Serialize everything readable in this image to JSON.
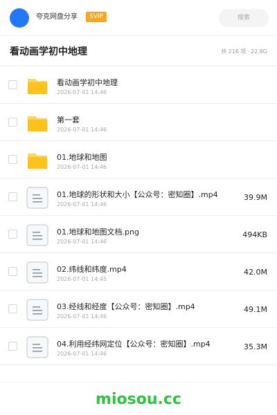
{
  "header": {
    "username": "夸克网盘分享",
    "badge": "SVIP",
    "search_placeholder": "搜索",
    "avatar_color": "#2478f5"
  },
  "folder": {
    "title": "看动画学初中地理",
    "item_count": "共 216 项",
    "separator": "·",
    "total_size": "22.8G"
  },
  "files": [
    {
      "type": "folder",
      "icon": "folder-icon",
      "name": "看动画学初中地理",
      "date": "2026-07-01 14:46",
      "size": ""
    },
    {
      "type": "folder",
      "icon": "folder-icon",
      "name": "第一套",
      "date": "2026-07-01 14:46",
      "size": ""
    },
    {
      "type": "folder",
      "icon": "folder-icon",
      "name": "01.地球和地图",
      "date": "2026-07-01 14:46",
      "size": ""
    },
    {
      "type": "file",
      "icon": "document-file-icon",
      "name": "01.地球的形状和大小【公众号：密知圈】.mp4",
      "date": "2026-07-01 14:46",
      "size": "39.9M"
    },
    {
      "type": "file",
      "icon": "document-file-icon",
      "name": "01.地球和地图文档.png",
      "date": "2026-07-01 14:46",
      "size": "494KB"
    },
    {
      "type": "file",
      "icon": "document-file-icon",
      "name": "02.纬线和纬度.mp4",
      "date": "2026-07-01 14:45",
      "size": "42.0M"
    },
    {
      "type": "file",
      "icon": "document-file-icon",
      "name": "03.经线和经度【公众号：密知圈】.mp4",
      "date": "2026-07-01 14:46",
      "size": "49.1M"
    },
    {
      "type": "file",
      "icon": "document-file-icon",
      "name": "04.利用经纬网定位【公众号：密知圈】.mp4",
      "date": "2026-07-01 14:46",
      "size": "35.3M"
    }
  ],
  "watermark": {
    "text": "miosou.cc",
    "color": "#2fc240"
  },
  "colors": {
    "folder": "#ffc21a",
    "svip_badge": "#f5a623"
  }
}
